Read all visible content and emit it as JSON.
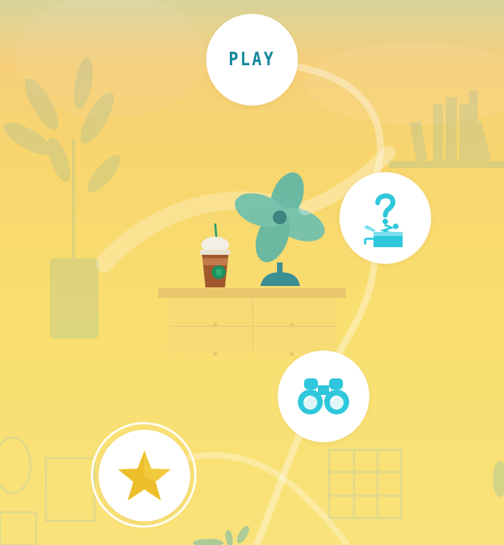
{
  "menu": {
    "play_label": "PLAY"
  },
  "icons": {
    "play": "play-button",
    "mystery": "jack-in-the-box-question-icon",
    "binoculars": "binoculars-icon",
    "star": "star-icon"
  },
  "colors": {
    "accent": "#12879a",
    "icon_cyan": "#2fc7dc",
    "star_gold": "#ecbf2a",
    "background_top": "#d9d49c",
    "background_main": "#f9df70"
  }
}
